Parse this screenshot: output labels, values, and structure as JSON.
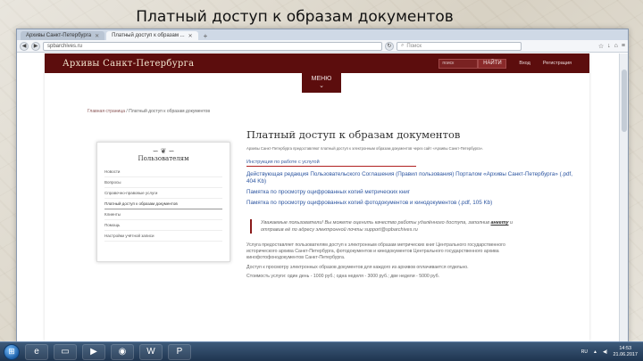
{
  "slide": {
    "title": "Платный доступ к образам документов"
  },
  "browser": {
    "tabs": [
      {
        "label": "Архивы Санкт-Петербурга"
      },
      {
        "label": "Платный доступ к образам ..."
      }
    ],
    "url": "spbarchives.ru",
    "search_placeholder": "Поиск"
  },
  "site": {
    "logo": "Архивы Санкт-Петербурга",
    "search_placeholder": "поиск",
    "find_label": "НАЙТИ",
    "login_label": "Вход",
    "register_label": "Регистрация",
    "menu_label": "МЕНЮ",
    "breadcrumb_home": "Главная страница",
    "breadcrumb_current": "Платный доступ к образам документов"
  },
  "sidebar": {
    "title": "Пользователям",
    "items": [
      {
        "label": "Новости"
      },
      {
        "label": "Вопросы"
      },
      {
        "label": "Справочно-правовые услуги"
      },
      {
        "label": "Платный доступ к образам документов"
      },
      {
        "label": "Клиенты"
      },
      {
        "label": "Помощь"
      },
      {
        "label": "Настройки учётной записи"
      }
    ]
  },
  "main": {
    "title": "Платный доступ к образам документов",
    "intro": "Архивы Санкт-Петербурга предоставляют платный доступ к электронным образам документов через сайт «Архивы Санкт-Петербурга».",
    "instruction_link": "Инструкция по работе с услугой",
    "links": [
      "Действующая редакция Пользовательского Соглашения (Правил пользования) Порталом «Архивы Санкт-Петербурга» (.pdf, 404 Kb)",
      "Памятка по просмотру оцифрованных копий метрических книг",
      "Памятка по просмотру оцифрованных копий фотодокументов и кинодокументов (.pdf, 105 Kb)"
    ],
    "notice_before": "Уважаемые пользователи! Вы можете оценить качество работы удалённого доступа, заполнив ",
    "notice_bold": "анкету",
    "notice_after": " и отправив её по адресу электронной почты support@spbarchives.ru",
    "paragraphs": [
      "Услуга предоставляет пользователям доступ к электронным образам метрических книг Центрального государственного исторического архива Санкт-Петербурга, фотодокументов и кинодокументов Центрального государственного архива кинофотофонодокументов Санкт-Петербурга.",
      "Доступ к просмотру электронных образов документов для каждого из архивов оплачивается отдельно.",
      "Стоимость услуги: один день - 1000 руб.; одна неделя - 3000 руб.; две недели - 5000 руб."
    ]
  },
  "taskbar": {
    "time": "14:53",
    "date": "21.06.2017",
    "lang": "RU"
  }
}
